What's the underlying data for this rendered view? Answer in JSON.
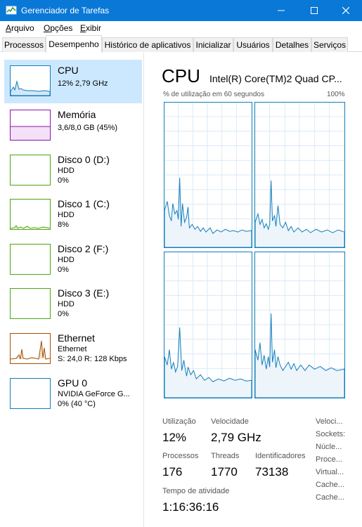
{
  "window": {
    "title": "Gerenciador de Tarefas",
    "controls": {
      "minimize": "—",
      "maximize": "☐",
      "close": "✕"
    }
  },
  "menu": [
    {
      "label": "Arquivo",
      "accel": "A",
      "rest": "rquivo"
    },
    {
      "label": "Opções",
      "accel": "O",
      "rest": "pções"
    },
    {
      "label": "Exibir",
      "accel": "E",
      "rest": "xibir"
    }
  ],
  "tabs": [
    "Processos",
    "Desempenho",
    "Histórico de aplicativos",
    "Inicializar",
    "Usuários",
    "Detalhes",
    "Serviços"
  ],
  "sidebar": [
    {
      "name": "CPU",
      "line1": "12% 2,79 GHz",
      "line2": "",
      "color": "#117dbb"
    },
    {
      "name": "Memória",
      "line1": "3,6/8,0 GB (45%)",
      "line2": "",
      "color": "#8b12ae"
    },
    {
      "name": "Disco 0 (D:)",
      "line1": "HDD",
      "line2": "0%",
      "color": "#4da60c"
    },
    {
      "name": "Disco 1 (C:)",
      "line1": "HDD",
      "line2": "8%",
      "color": "#4da60c"
    },
    {
      "name": "Disco 2 (F:)",
      "line1": "HDD",
      "line2": "0%",
      "color": "#4da60c"
    },
    {
      "name": "Disco 3 (E:)",
      "line1": "HDD",
      "line2": "0%",
      "color": "#4da60c"
    },
    {
      "name": "Ethernet",
      "line1": "Ethernet",
      "line2": "S: 24,0  R: 128 Kbps",
      "color": "#a74f01"
    },
    {
      "name": "GPU 0",
      "line1": "NVIDIA GeForce G...",
      "line2": "0% (40 °C)",
      "color": "#117dbb"
    }
  ],
  "main": {
    "title": "CPU",
    "model": "Intel(R) Core(TM)2 Quad CP...",
    "util_label": "% de utilização em 60 segundos",
    "util_max": "100%",
    "stats": {
      "utilizacao_label": "Utilização",
      "utilizacao": "12%",
      "velocidade_label": "Velocidade",
      "velocidade": "2,79 GHz",
      "processos_label": "Processos",
      "processos": "176",
      "threads_label": "Threads",
      "threads": "1770",
      "identificadores_label": "Identificadores",
      "identificadores": "73138",
      "tempo_label": "Tempo de atividade",
      "tempo": "1:16:36:16"
    },
    "right_labels": [
      "Veloci...",
      "Sockets:",
      "Núcle...",
      "Proce...",
      "Virtual...",
      "Cache...",
      "Cache..."
    ]
  }
}
